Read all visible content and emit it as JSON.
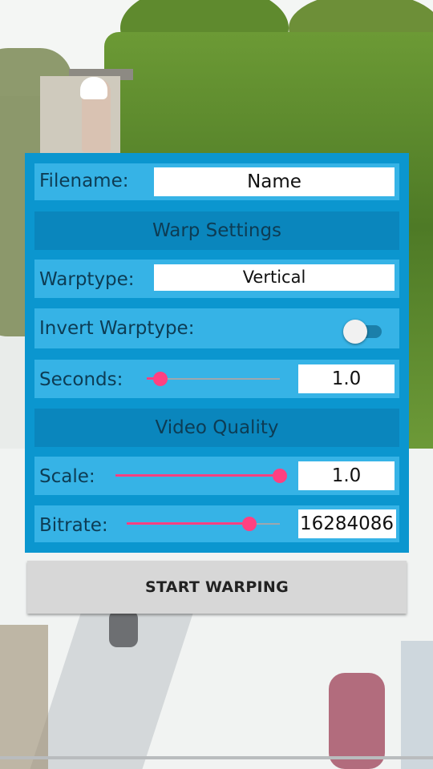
{
  "filename": {
    "label": "Filename:",
    "value": "Name"
  },
  "warp_settings": {
    "header": "Warp Settings",
    "warptype": {
      "label": "Warptype:",
      "value": "Vertical"
    },
    "invert": {
      "label": "Invert Warptype:",
      "checked": false
    },
    "seconds": {
      "label": "Seconds:",
      "value": "1.0",
      "slider_fraction": 0.1
    }
  },
  "video_quality": {
    "header": "Video Quality",
    "scale": {
      "label": "Scale:",
      "value": "1.0",
      "slider_fraction": 1.0
    },
    "bitrate": {
      "label": "Bitrate:",
      "value": "16284086",
      "slider_fraction": 0.8
    }
  },
  "start_button": {
    "label": "START WARPING"
  },
  "colors": {
    "panel": "#0b96cf",
    "row": "#36b3e6",
    "header": "#0a86bd",
    "accent": "#ff4081",
    "button": "#d7d7d7"
  }
}
